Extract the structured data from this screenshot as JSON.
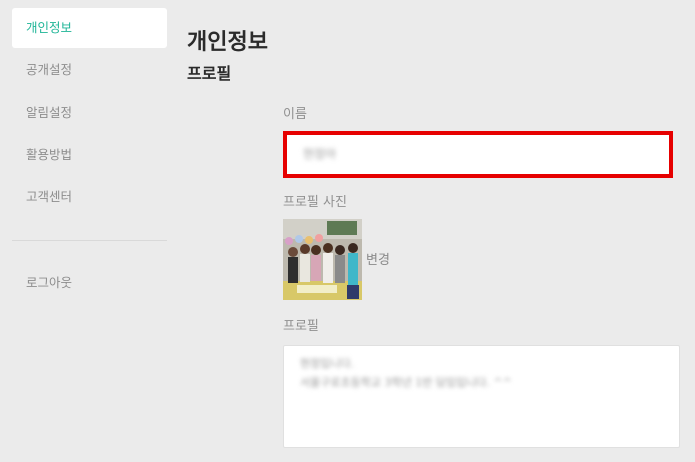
{
  "sidebar": {
    "items": [
      {
        "label": "개인정보",
        "active": true
      },
      {
        "label": "공개설정",
        "active": false
      },
      {
        "label": "알림설정",
        "active": false
      },
      {
        "label": "활용방법",
        "active": false
      },
      {
        "label": "고객센터",
        "active": false
      }
    ],
    "logout_label": "로그아웃"
  },
  "main": {
    "title": "개인정보",
    "section_title": "프로필",
    "name_label": "이름",
    "name_value": "현정아",
    "photo_label": "프로필 사진",
    "change_label": "변경",
    "profile_label": "프로필",
    "profile_lines": [
      "현정입니다.",
      "서울구로초등학교 3학년 1반 담임입니다. ^^"
    ]
  },
  "colors": {
    "accent": "#1fb597",
    "highlight_border": "#e60000",
    "background": "#ebebeb"
  }
}
